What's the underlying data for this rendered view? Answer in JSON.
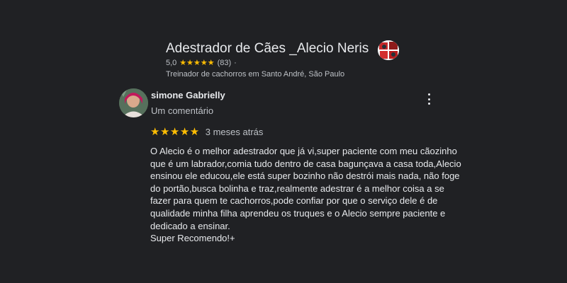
{
  "business": {
    "title": "Adestrador de Cães _Alecio Neris",
    "rating": "5,0",
    "stars": "★★★★★",
    "review_count": "(83)",
    "separator": "·",
    "subtitle": "Treinador de cachorros em Santo André, São Paulo",
    "avatar_icon": "business-avatar-icon"
  },
  "review": {
    "author": "simone Gabrielly",
    "meta": "Um comentário",
    "stars": "★★★★★",
    "date": "3 meses atrás",
    "text": "O Alecio é o melhor adestrador que já vi,super paciente com meu cãozinho\nque é um labrador,comia tudo dentro de casa bagunçava a casa toda,Alecio\nensinou ele educou,ele está super bozinho não destrói mais nada, não foge\ndo portão,busca bolinha e traz,realmente adestrar é a melhor coisa a se\nfazer para quem te cachorros,pode confiar por que o serviço dele é de\nqualidade minha filha aprendeu os truques e o Alecio sempre paciente e\ndedicado a ensinar.\nSuper Recomendo!+",
    "more_icon": "more-vert-icon"
  },
  "colors": {
    "background": "#202124",
    "star": "#fbbc04",
    "text_primary": "#e8eaed",
    "text_secondary": "#bdc1c6"
  }
}
